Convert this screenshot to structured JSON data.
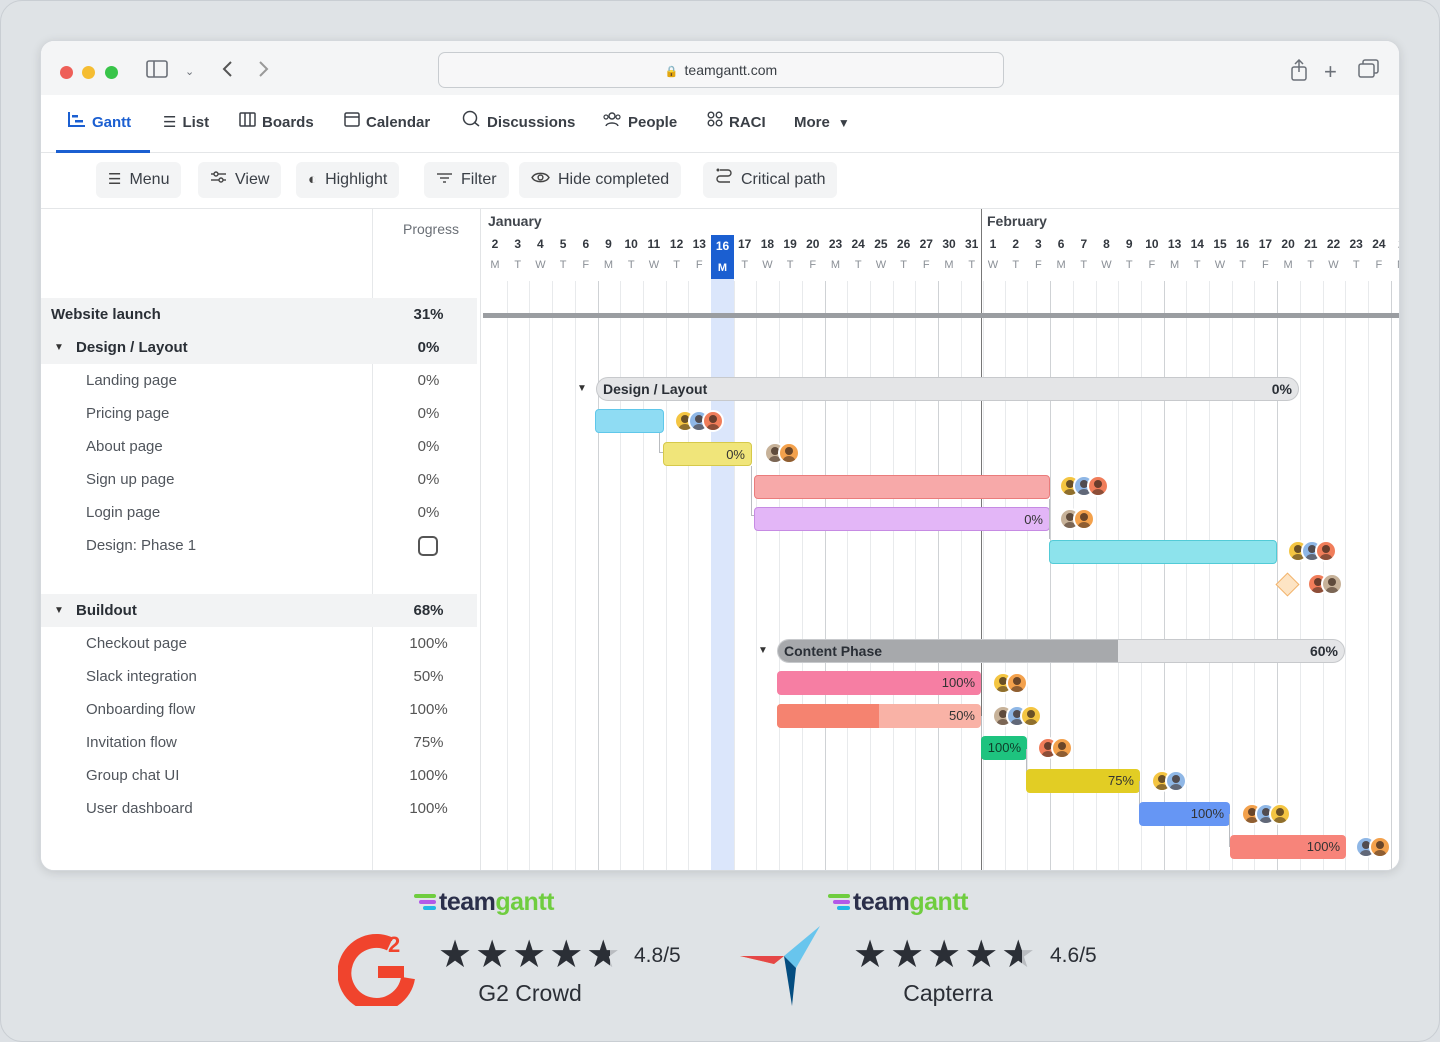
{
  "browser": {
    "url": "teamgantt.com"
  },
  "nav": {
    "items": [
      {
        "label": "Gantt",
        "icon": "gantt-icon"
      },
      {
        "label": "List",
        "icon": "list-icon"
      },
      {
        "label": "Boards",
        "icon": "boards-icon"
      },
      {
        "label": "Calendar",
        "icon": "calendar-icon"
      },
      {
        "label": "Discussions",
        "icon": "discussions-icon"
      },
      {
        "label": "People",
        "icon": "people-icon"
      },
      {
        "label": "RACI",
        "icon": "raci-icon"
      },
      {
        "label": "More",
        "icon": "caret-down-icon"
      }
    ],
    "active": "Gantt"
  },
  "toolbar": {
    "menu": "Menu",
    "view": "View",
    "highlight": "Highlight",
    "filter": "Filter",
    "hide_completed": "Hide completed",
    "critical_path": "Critical path"
  },
  "tasks": {
    "progress_header": "Progress",
    "project": {
      "name": "Website launch",
      "progress": "31%"
    },
    "design_group": {
      "name": "Design / Layout",
      "progress": "0%"
    },
    "design_items": [
      {
        "name": "Landing page",
        "progress": "0%"
      },
      {
        "name": "Pricing page",
        "progress": "0%"
      },
      {
        "name": "About page",
        "progress": "0%"
      },
      {
        "name": "Sign up page",
        "progress": "0%"
      },
      {
        "name": "Login page",
        "progress": "0%"
      },
      {
        "name": "Design: Phase 1",
        "progress": ""
      }
    ],
    "buildout_group": {
      "name": "Buildout",
      "progress": "68%"
    },
    "buildout_items": [
      {
        "name": "Checkout page",
        "progress": "100%"
      },
      {
        "name": "Slack integration",
        "progress": "50%"
      },
      {
        "name": "Onboarding flow",
        "progress": "100%"
      },
      {
        "name": "Invitation flow",
        "progress": "75%"
      },
      {
        "name": "Group chat UI",
        "progress": "100%"
      },
      {
        "name": "User dashboard",
        "progress": "100%"
      }
    ]
  },
  "timeline": {
    "months": [
      "January",
      "February"
    ],
    "jan_days": [
      "2",
      "3",
      "4",
      "5",
      "6",
      "9",
      "10",
      "11",
      "12",
      "13",
      "16",
      "17",
      "18",
      "19",
      "20",
      "23",
      "24",
      "25",
      "26",
      "27",
      "30",
      "31"
    ],
    "jan_letters": [
      "M",
      "T",
      "W",
      "T",
      "F",
      "M",
      "T",
      "W",
      "T",
      "F",
      "M",
      "T",
      "W",
      "T",
      "F",
      "M",
      "T",
      "W",
      "T",
      "F",
      "M",
      "T"
    ],
    "feb_days": [
      "1",
      "2",
      "3",
      "6",
      "7",
      "8",
      "9",
      "10",
      "13",
      "14",
      "15",
      "16",
      "17",
      "20",
      "21",
      "22",
      "23",
      "24",
      "2"
    ],
    "feb_letters": [
      "W",
      "T",
      "F",
      "M",
      "T",
      "W",
      "T",
      "F",
      "M",
      "T",
      "W",
      "T",
      "F",
      "M",
      "T",
      "W",
      "T",
      "F",
      "M"
    ],
    "today": "16",
    "bars": {
      "design_group": {
        "label": "Design / Layout",
        "pct": "0%"
      },
      "pricing": "0%",
      "signup": "0%",
      "content_group": {
        "label": "Content Phase",
        "pct": "60%"
      },
      "checkout": "100%",
      "slack": "50%",
      "onboarding": "100%",
      "invitation": "75%",
      "groupchat": "100%",
      "dashboard": "100%"
    },
    "colors": {
      "landing": "#8fdcf3",
      "pricing": "#f0e57a",
      "about": "#f7a9a9",
      "signup": "#e3b6f7",
      "login": "#8de3ec",
      "checkout": "#f67ea3",
      "slack": "#f58370",
      "onboarding": "#1ec37f",
      "invitation": "#e2cd24",
      "groupchat": "#6696f4",
      "dashboard": "#f7847a"
    }
  },
  "ratings": [
    {
      "brand_a": "team",
      "brand_b": "gantt",
      "score": "4.8/5",
      "site": "G2 Crowd"
    },
    {
      "brand_a": "team",
      "brand_b": "gantt",
      "score": "4.6/5",
      "site": "Capterra"
    }
  ],
  "icons": {
    "g2": "g2-logo",
    "capterra": "capterra-logo"
  }
}
